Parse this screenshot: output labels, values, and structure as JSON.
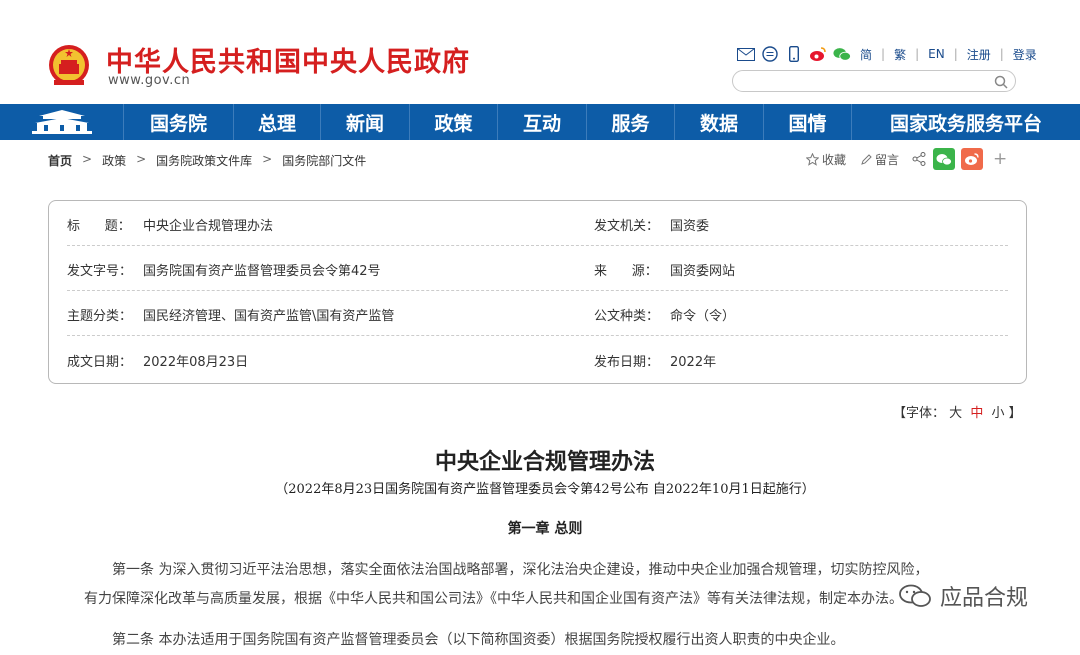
{
  "header": {
    "title": "中华人民共和国中央人民政府",
    "url": "www.gov.cn",
    "lang_simplified": "简",
    "lang_traditional": "繁",
    "lang_english": "EN",
    "register": "注册",
    "login": "登录",
    "search_placeholder": ""
  },
  "nav": {
    "items": [
      "国务院",
      "总理",
      "新闻",
      "政策",
      "互动",
      "服务",
      "数据",
      "国情",
      "国家政务服务平台"
    ]
  },
  "breadcrumb": {
    "items": [
      "首页",
      "政策",
      "国务院政策文件库",
      "国务院部门文件"
    ],
    "separator": ">"
  },
  "tools": {
    "favorite": "收藏",
    "comment": "留言",
    "more": "+"
  },
  "info": {
    "title_label": "标      题：",
    "title_value": "中央企业合规管理办法",
    "issuer_label": "发文机关：",
    "issuer_value": "国资委",
    "docno_label": "发文字号：",
    "docno_value": "国务院国有资产监督管理委员会令第42号",
    "source_label": "来      源：",
    "source_value": "国资委网站",
    "topic_label": "主题分类：",
    "topic_value": "国民经济管理、国有资产监管\\国有资产监管",
    "type_label": "公文种类：",
    "type_value": "命令（令）",
    "written_label": "成文日期：",
    "written_value": "2022年08月23日",
    "published_label": "发布日期：",
    "published_value": "2022年"
  },
  "font_size": {
    "prefix": "【字体：",
    "large": "大",
    "medium": "中",
    "small": "小",
    "suffix": "】"
  },
  "document": {
    "title": "中央企业合规管理办法",
    "subtitle": "（2022年8月23日国务院国有资产监督管理委员会令第42号公布 自2022年10月1日起施行）",
    "chapter": "第一章 总则",
    "para1_line1": "第一条 为深入贯彻习近平法治思想，落实全面依法治国战略部署，深化法治央企建设，推动中央企业加强合规管理，切实防控风险，",
    "para1_line2": "有力保障深化改革与高质量发展，根据《中华人民共和国公司法》《中华人民共和国企业国有资产法》等有关法律法规，制定本办法。",
    "para2_line1": "第二条 本办法适用于国务院国有资产监督管理委员会（以下简称国资委）根据国务院授权履行出资人职责的中央企业。"
  },
  "watermark": {
    "text": "应品合规"
  },
  "colors": {
    "title_red": "#d51f1f",
    "nav_blue": "#0d5ca7",
    "link_blue": "#1a4b8c",
    "wechat_green": "#3bb44a",
    "weibo_orange": "#f06a4a"
  }
}
